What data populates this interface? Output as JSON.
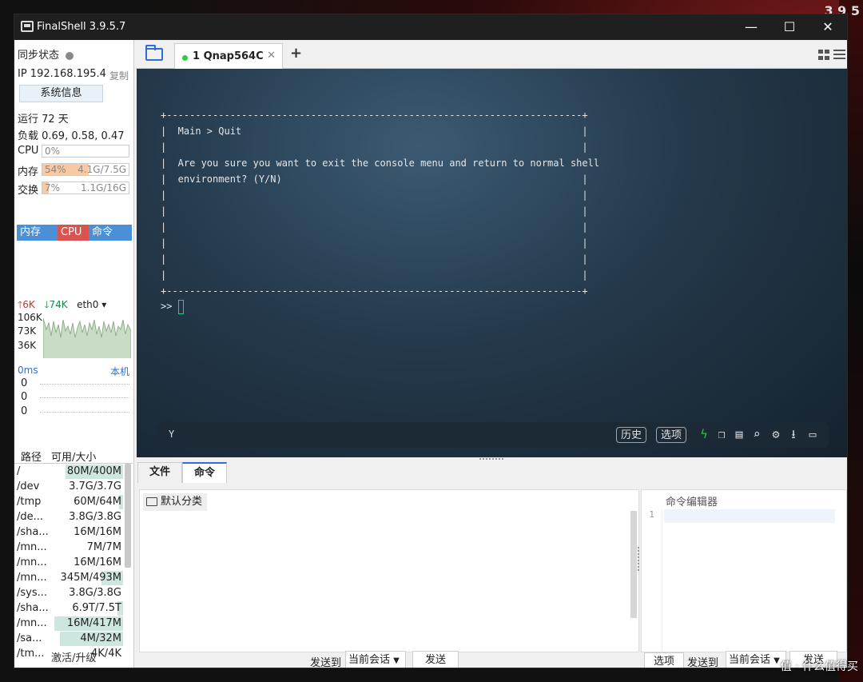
{
  "window": {
    "title": "FinalShell 3.9.5.7"
  },
  "desktop": {
    "corner_text": "3 9 5"
  },
  "left": {
    "sync_label": "同步状态",
    "ip_label": "IP 192.168.195.4",
    "copy_label": "复制",
    "sysinfo_button": "系统信息",
    "uptime": "运行 72 天",
    "load": "负载 0.69, 0.58, 0.47",
    "cpu": {
      "label": "CPU",
      "percent": "0%",
      "value": "",
      "fill": 0
    },
    "mem": {
      "label": "内存",
      "percent": "54%",
      "value": "4.1G/7.5G",
      "fill": 0.54
    },
    "swap": {
      "label": "交换",
      "percent": "7%",
      "value": "1.1G/16G",
      "fill": 0.07
    },
    "tabs": [
      "内存",
      "CPU",
      "命令"
    ],
    "tab_colors": [
      "#4a8fd8",
      "#d9534f",
      "#4a8fd8"
    ],
    "net": {
      "up": "6K",
      "down": "74K",
      "iface": "eth0",
      "y_labels": [
        "106K",
        "73K",
        "36K"
      ]
    },
    "ping": {
      "latency": "0ms",
      "host": "本机",
      "y_labels": [
        "0",
        "0",
        "0"
      ]
    },
    "disk": {
      "headers": [
        "路径",
        "可用/大小"
      ],
      "rows": [
        {
          "path": "/",
          "size": "80M/400M",
          "fill": 0.8
        },
        {
          "path": "/dev",
          "size": "3.7G/3.7G",
          "fill": 0
        },
        {
          "path": "/tmp",
          "size": "60M/64M",
          "fill": 0.06
        },
        {
          "path": "/de...",
          "size": "3.8G/3.8G",
          "fill": 0
        },
        {
          "path": "/sha...",
          "size": "16M/16M",
          "fill": 0
        },
        {
          "path": "/mn...",
          "size": "7M/7M",
          "fill": 0
        },
        {
          "path": "/mn...",
          "size": "16M/16M",
          "fill": 0
        },
        {
          "path": "/mn...",
          "size": "345M/493M",
          "fill": 0.3
        },
        {
          "path": "/sys...",
          "size": "3.8G/3.8G",
          "fill": 0
        },
        {
          "path": "/sha...",
          "size": "6.9T/7.5T",
          "fill": 0.08
        },
        {
          "path": "/mn...",
          "size": "16M/417M",
          "fill": 0.96
        },
        {
          "path": "/sa...",
          "size": "4M/32M",
          "fill": 0.88
        },
        {
          "path": "/tm...",
          "size": "4K/4K",
          "fill": 0
        }
      ]
    },
    "activate": "激活/升级"
  },
  "tabs": {
    "session_number": "1",
    "session_name": "Qnap564C"
  },
  "terminal": {
    "lines": [
      "+------------------------------------------------------------------------+",
      "|  Main > Quit                                                           |",
      "|                                                                        |",
      "|  Are you sure you want to exit the console menu and return to normal shell",
      "|  environment? (Y/N)                                                    |",
      "|                                                                        |",
      "|                                                                        |",
      "|                                                                        |",
      "|                                                                        |",
      "|                                                                        |",
      "|                                                                        |",
      "+------------------------------------------------------------------------+"
    ],
    "prompt": ">>",
    "input_value": "Y",
    "history_btn": "历史",
    "options_btn": "选项"
  },
  "lower": {
    "tab_files": "文件",
    "tab_commands": "命令",
    "category": "默认分类",
    "editor_title": "命令编辑器",
    "editor_line_no": "1",
    "send_to_label": "发送到",
    "session_select": "当前会话",
    "send_btn": "发送",
    "options_btn": "选项",
    "send_to_label2": "发送到",
    "session_select2": "当前会话",
    "send_btn2": "发送"
  },
  "watermark": "值 · 什么值得买"
}
